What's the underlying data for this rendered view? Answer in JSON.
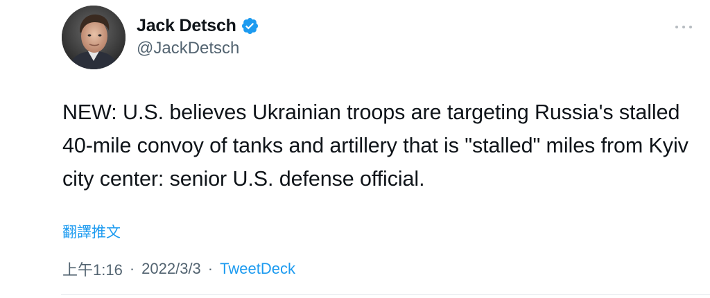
{
  "user": {
    "display_name": "Jack Detsch",
    "handle": "@JackDetsch",
    "verified": true
  },
  "tweet": {
    "text": "NEW: U.S. believes Ukrainian troops are targeting Russia's stalled 40-mile convoy of tanks and artillery that is \"stalled\" miles from Kyiv city center: senior U.S. defense official.",
    "translate_label": "翻譯推文",
    "time": "上午1:16",
    "date": "2022/3/3",
    "separator": "·",
    "source": "TweetDeck"
  },
  "colors": {
    "accent": "#1d9bf0",
    "text": "#0f1419",
    "muted": "#536471"
  },
  "icons": {
    "verified": "verified-badge-icon",
    "more": "more-options-icon"
  }
}
